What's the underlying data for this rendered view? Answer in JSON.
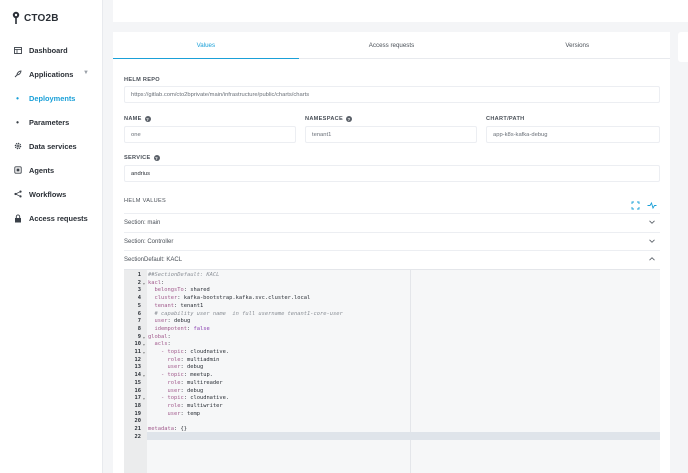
{
  "brand": {
    "logo_text": "CTO2B"
  },
  "sidebar": {
    "items": [
      {
        "label": "Dashboard",
        "icon": "dashboard-icon"
      },
      {
        "label": "Applications",
        "icon": "rocket-icon",
        "has_chevron": true
      },
      {
        "label": "Deployments",
        "icon": "dot-icon",
        "active": true
      },
      {
        "label": "Parameters",
        "icon": "dot-icon"
      },
      {
        "label": "Data services",
        "icon": "gear-icon"
      },
      {
        "label": "Agents",
        "icon": "agent-icon"
      },
      {
        "label": "Workflows",
        "icon": "workflow-icon"
      },
      {
        "label": "Access requests",
        "icon": "lock-icon"
      }
    ]
  },
  "tabs": [
    {
      "label": "Values",
      "active": true
    },
    {
      "label": "Access requests"
    },
    {
      "label": "Versions"
    }
  ],
  "form": {
    "helm_repo_label": "HELM REPO",
    "helm_repo_value": "https://gitlab.com/cto2bprivate/main/infrastructure/public/charts/charts",
    "name_label": "NAME",
    "name_value": "one",
    "namespace_label": "NAMESPACE",
    "namespace_value": "tenant1",
    "chart_label": "CHART/PATH",
    "chart_value": "app-k8s-kafka-debug",
    "service_label": "SERVICE",
    "service_value": "andrius",
    "helm_values_label": "HELM VALUES"
  },
  "sections": [
    {
      "label": "Section: main",
      "expanded": false
    },
    {
      "label": "Section: Controller",
      "expanded": false
    },
    {
      "label": "SectionDefault: KACL",
      "expanded": true
    }
  ],
  "editor": {
    "lines": [
      {
        "n": "1",
        "fold": "",
        "text": "##SectionDefault: KACL",
        "kind": "comment"
      },
      {
        "n": "2",
        "fold": "▾",
        "text": "kacl:",
        "kind": "key"
      },
      {
        "n": "3",
        "fold": "",
        "text": "  belongsTo: shared",
        "kind": "kv"
      },
      {
        "n": "4",
        "fold": "",
        "text": "  cluster: kafka-bootstrap.kafka.svc.cluster.local",
        "kind": "kv"
      },
      {
        "n": "5",
        "fold": "",
        "text": "  tenant: tenant1",
        "kind": "kv"
      },
      {
        "n": "6",
        "fold": "",
        "text": "  # capability user name  in full username tenant1-core-user",
        "kind": "comment"
      },
      {
        "n": "7",
        "fold": "",
        "text": "  user: debug",
        "kind": "kv"
      },
      {
        "n": "8",
        "fold": "",
        "text": "  idempotent: false",
        "kind": "kv"
      },
      {
        "n": "9",
        "fold": "▾",
        "text": "global:",
        "kind": "key"
      },
      {
        "n": "10",
        "fold": "▾",
        "text": "  acls:",
        "kind": "key"
      },
      {
        "n": "11",
        "fold": "▾",
        "text": "    - topic: cloudnative.",
        "kind": "kv"
      },
      {
        "n": "12",
        "fold": "",
        "text": "      role: multiadmin",
        "kind": "kv"
      },
      {
        "n": "13",
        "fold": "",
        "text": "      user: debug",
        "kind": "kv"
      },
      {
        "n": "14",
        "fold": "▾",
        "text": "    - topic: meetup.",
        "kind": "kv"
      },
      {
        "n": "15",
        "fold": "",
        "text": "      role: multireader",
        "kind": "kv"
      },
      {
        "n": "16",
        "fold": "",
        "text": "      user: debug",
        "kind": "kv"
      },
      {
        "n": "17",
        "fold": "▾",
        "text": "    - topic: cloudnative.",
        "kind": "kv"
      },
      {
        "n": "18",
        "fold": "",
        "text": "      role: multiwriter",
        "kind": "kv"
      },
      {
        "n": "19",
        "fold": "",
        "text": "      user: temp",
        "kind": "kv"
      },
      {
        "n": "20",
        "fold": "",
        "text": "",
        "kind": "blank"
      },
      {
        "n": "21",
        "fold": "",
        "text": "metadata: {}",
        "kind": "kv"
      },
      {
        "n": "22",
        "fold": "",
        "text": "",
        "kind": "blank"
      }
    ]
  },
  "colors": {
    "accent": "#1aa0d8"
  }
}
